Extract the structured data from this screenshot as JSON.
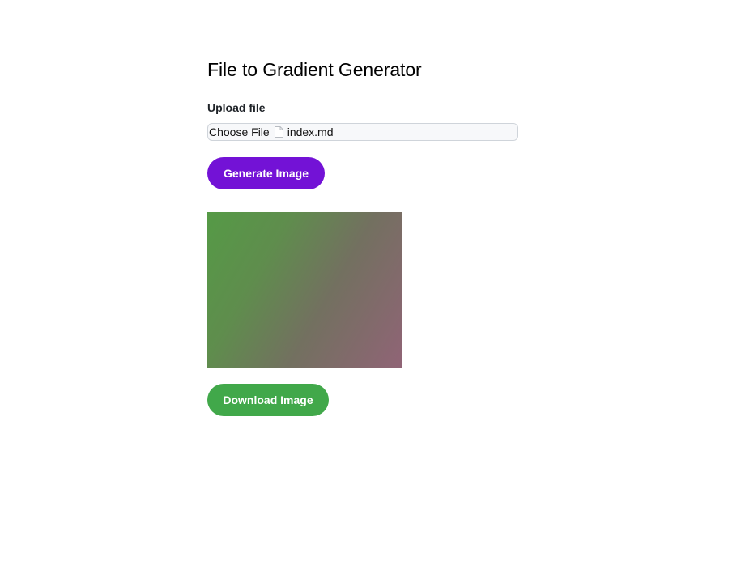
{
  "title": "File to Gradient Generator",
  "upload": {
    "label": "Upload file",
    "choose_label": "Choose File",
    "file_name": "index.md",
    "file_icon": "document-icon"
  },
  "buttons": {
    "generate_label": "Generate Image",
    "download_label": "Download Image"
  },
  "colors": {
    "generate_button": "#7312d6",
    "download_button": "#41a84a",
    "gradient_start": "#559a46",
    "gradient_end": "#906476"
  }
}
